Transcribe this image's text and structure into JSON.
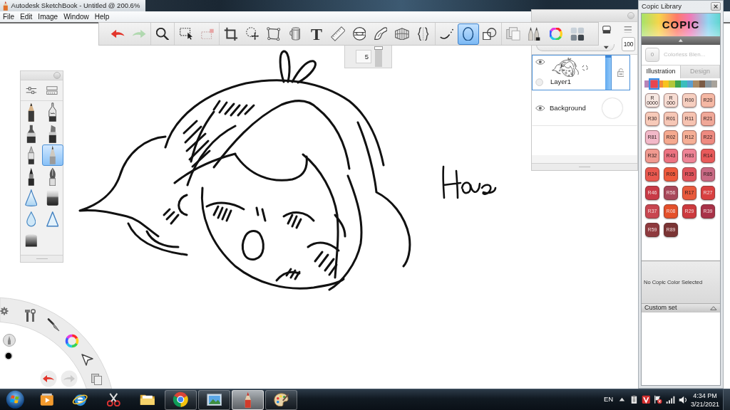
{
  "window": {
    "title": "Autodesk SketchBook - Untitled @ 200.6%"
  },
  "menu": [
    "File",
    "Edit",
    "Image",
    "Window",
    "Help"
  ],
  "toolbar": {
    "groups": [
      [
        {
          "kind": "undo",
          "selected": false,
          "disabled": false
        },
        {
          "kind": "redo",
          "selected": false,
          "disabled": true
        }
      ],
      [
        {
          "kind": "zoom",
          "selected": false,
          "disabled": false
        }
      ],
      [
        {
          "kind": "select",
          "selected": false,
          "disabled": false
        },
        {
          "kind": "layerselect",
          "selected": false,
          "disabled": true
        }
      ],
      [
        {
          "kind": "crop",
          "selected": false,
          "disabled": false
        },
        {
          "kind": "transform",
          "selected": false,
          "disabled": false
        },
        {
          "kind": "distort",
          "selected": false,
          "disabled": false
        },
        {
          "kind": "fill",
          "selected": false,
          "disabled": false
        },
        {
          "kind": "text",
          "label": "T",
          "selected": false,
          "disabled": false
        },
        {
          "kind": "ruler",
          "selected": false,
          "disabled": false
        },
        {
          "kind": "ellipseguide",
          "selected": false,
          "disabled": false
        },
        {
          "kind": "frenchcurve",
          "selected": false,
          "disabled": false
        },
        {
          "kind": "perspective",
          "selected": false,
          "disabled": false
        },
        {
          "kind": "symmetry",
          "selected": false,
          "disabled": false
        }
      ],
      [
        {
          "kind": "line",
          "selected": false,
          "disabled": false
        },
        {
          "kind": "ellipse",
          "selected": true,
          "disabled": false
        },
        {
          "kind": "shapes",
          "selected": false,
          "disabled": false
        }
      ],
      [
        {
          "kind": "copy",
          "selected": false,
          "disabled": false
        },
        {
          "kind": "brushes",
          "selected": false,
          "disabled": false
        },
        {
          "kind": "color",
          "selected": false,
          "disabled": false
        },
        {
          "kind": "swatches",
          "selected": false,
          "disabled": false
        }
      ]
    ]
  },
  "brush_size": {
    "value": "5",
    "level": 1
  },
  "brush_palette": {
    "brushes": [
      {
        "kind": "pencil",
        "selected": false
      },
      {
        "kind": "techpen",
        "selected": false
      },
      {
        "kind": "marker",
        "selected": false
      },
      {
        "kind": "chisel",
        "selected": false
      },
      {
        "kind": "ballpoint",
        "selected": false
      },
      {
        "kind": "finepencil",
        "selected": true
      },
      {
        "kind": "brushpen",
        "selected": false
      },
      {
        "kind": "nib",
        "selected": false
      },
      {
        "kind": "softtriangle",
        "selected": false
      },
      {
        "kind": "block",
        "selected": false
      },
      {
        "kind": "droplet",
        "selected": false
      },
      {
        "kind": "triangle",
        "selected": false
      },
      {
        "kind": "roundblock",
        "selected": false
      }
    ]
  },
  "layers_panel": {
    "opacity": "100",
    "layers": [
      {
        "kind": "paint",
        "name": "Layer1",
        "visible": true,
        "selected": true,
        "level": 1
      },
      {
        "kind": "background",
        "name": "Background",
        "visible": true,
        "selected": false
      }
    ]
  },
  "copic_library": {
    "title": "Copic Library",
    "logo": "COPIC",
    "blender": {
      "code": "0",
      "name": "Colorless Blen..."
    },
    "tabs": [
      {
        "label": "Illustration",
        "selected": true
      },
      {
        "label": "Design",
        "selected": false
      }
    ],
    "hues": [
      {
        "color": "#b784b8",
        "selected": false
      },
      {
        "color": "#e8454f",
        "selected": true
      },
      {
        "color": "#f28c38",
        "selected": false
      },
      {
        "color": "#f7c31d",
        "selected": false
      },
      {
        "color": "#b4c73a",
        "selected": false
      },
      {
        "color": "#3ea54f",
        "selected": false
      },
      {
        "color": "#3bbdbd",
        "selected": false
      },
      {
        "color": "#5aa0d2",
        "selected": false
      },
      {
        "color": "#a98a64",
        "selected": false
      },
      {
        "color": "#7b5b45",
        "selected": false
      },
      {
        "color": "#8c979d",
        "selected": false
      },
      {
        "color": "#a8a39b",
        "selected": false
      }
    ],
    "swatches": [
      {
        "label": "R\n0000",
        "color": "#f6e8e2"
      },
      {
        "label": "R\n000",
        "color": "#f7ddd3"
      },
      {
        "label": "R00",
        "color": "#f6cfc0"
      },
      {
        "label": "R20",
        "color": "#f5b8a4"
      },
      {
        "label": "R30",
        "color": "#f7cab9"
      },
      {
        "label": "R01",
        "color": "#f6c7b6"
      },
      {
        "label": "R11",
        "color": "#f6c3b1"
      },
      {
        "label": "R21",
        "color": "#f0a898"
      },
      {
        "label": "R81",
        "color": "#f2b9c9"
      },
      {
        "label": "R02",
        "color": "#f5a98f"
      },
      {
        "label": "R12",
        "color": "#f5af96"
      },
      {
        "label": "R22",
        "color": "#ee8a80"
      },
      {
        "label": "R32",
        "color": "#f09a90"
      },
      {
        "label": "R43",
        "color": "#ec7381"
      },
      {
        "label": "R83",
        "color": "#ee8496"
      },
      {
        "label": "R14",
        "color": "#e85a5a"
      },
      {
        "label": "R24",
        "color": "#e9584e"
      },
      {
        "label": "R05",
        "color": "#ee5a3c"
      },
      {
        "label": "R35",
        "color": "#e0545c"
      },
      {
        "label": "R85",
        "color": "#c96a84"
      },
      {
        "label": "R46",
        "color": "#c83a46"
      },
      {
        "label": "R56",
        "color": "#a8485a"
      },
      {
        "label": "R17",
        "color": "#e85a3c"
      },
      {
        "label": "R27",
        "color": "#d84040"
      },
      {
        "label": "R37",
        "color": "#c84650"
      },
      {
        "label": "R08",
        "color": "#e4502a"
      },
      {
        "label": "R29",
        "color": "#cc3a3e"
      },
      {
        "label": "R39",
        "color": "#a83248"
      },
      {
        "label": "R59",
        "color": "#8e3a3e"
      },
      {
        "label": "R89",
        "color": "#7a3434"
      }
    ],
    "status": "No Copic Color Selected",
    "custom_set": {
      "title": "Custom set",
      "expanded": true
    }
  },
  "taskbar": {
    "apps": [
      {
        "kind": "player",
        "running": false,
        "active": false
      },
      {
        "kind": "globe",
        "running": false,
        "active": false
      },
      {
        "kind": "scissors",
        "running": false,
        "active": false
      },
      {
        "kind": "folder",
        "running": false,
        "active": false
      },
      {
        "kind": "tricolor",
        "running": true,
        "active": false
      },
      {
        "kind": "picture",
        "running": true,
        "active": false
      },
      {
        "kind": "pencil",
        "running": true,
        "active": true
      },
      {
        "kind": "palette",
        "running": true,
        "active": false
      }
    ],
    "tray": {
      "language": "EN",
      "time": "4:34 PM",
      "date": "3/21/2021"
    }
  }
}
